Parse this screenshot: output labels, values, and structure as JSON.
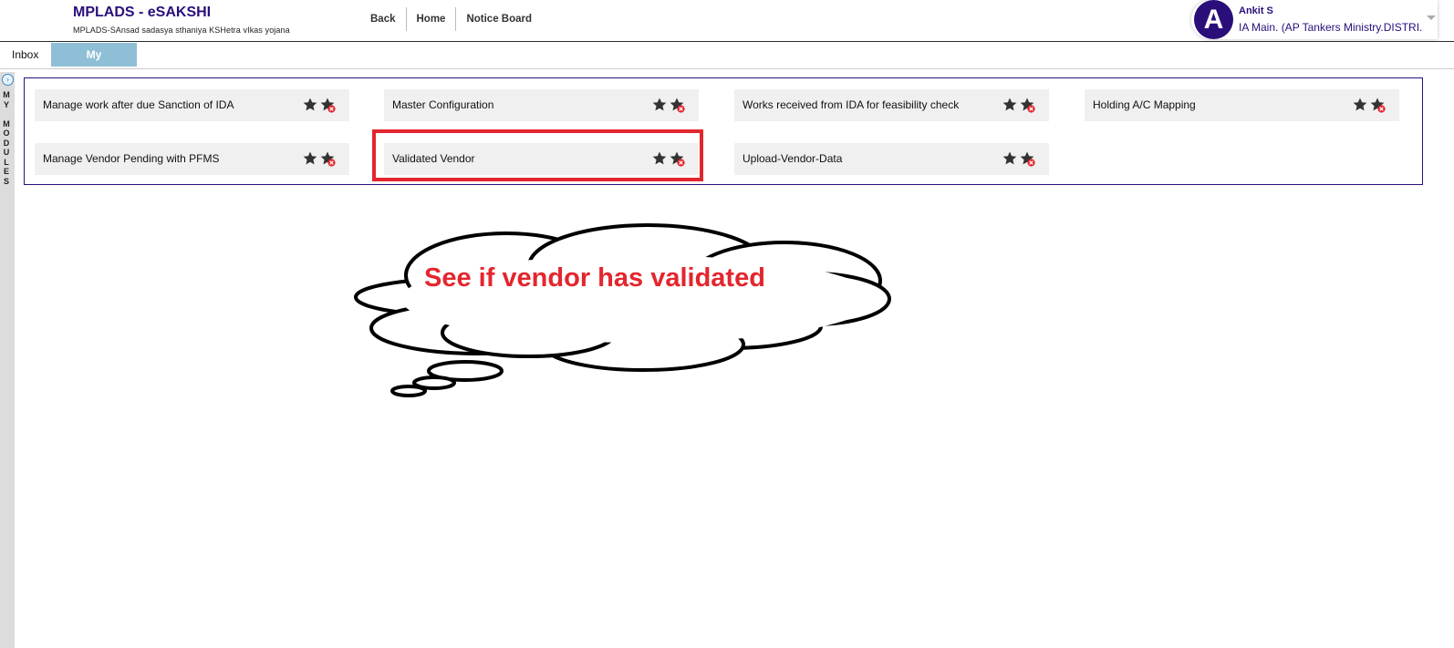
{
  "header": {
    "app_title": "MPLADS - eSAKSHI",
    "app_subtitle": "MPLADS-SAnsad sadasya sthaniya KSHetra vIkas yojana",
    "nav": [
      "Back",
      "Home",
      "Notice Board"
    ]
  },
  "user": {
    "avatar_letter": "A",
    "name": "Ankit S",
    "role": "IA Main. (AP Tankers Ministry.DISTRI..."
  },
  "tabs": [
    "Inbox",
    "My Modules"
  ],
  "side_rail": {
    "label": "MY MODULES"
  },
  "modules": [
    {
      "label": "Manage work after due Sanction of IDA"
    },
    {
      "label": "Master Configuration"
    },
    {
      "label": "Works received from IDA for feasibility check"
    },
    {
      "label": "Holding A/C Mapping"
    },
    {
      "label": "Manage Vendor Pending with PFMS"
    },
    {
      "label": "Validated Vendor"
    },
    {
      "label": "Upload-Vendor-Data"
    }
  ],
  "annotation": {
    "callout_text": "See if vendor has validated",
    "highlighted_module": "Validated Vendor",
    "color": "#e3262e"
  },
  "colors": {
    "brand": "#2a0f7a",
    "tab_active": "#8fbfd6",
    "module_bg": "#f0f0f0"
  }
}
